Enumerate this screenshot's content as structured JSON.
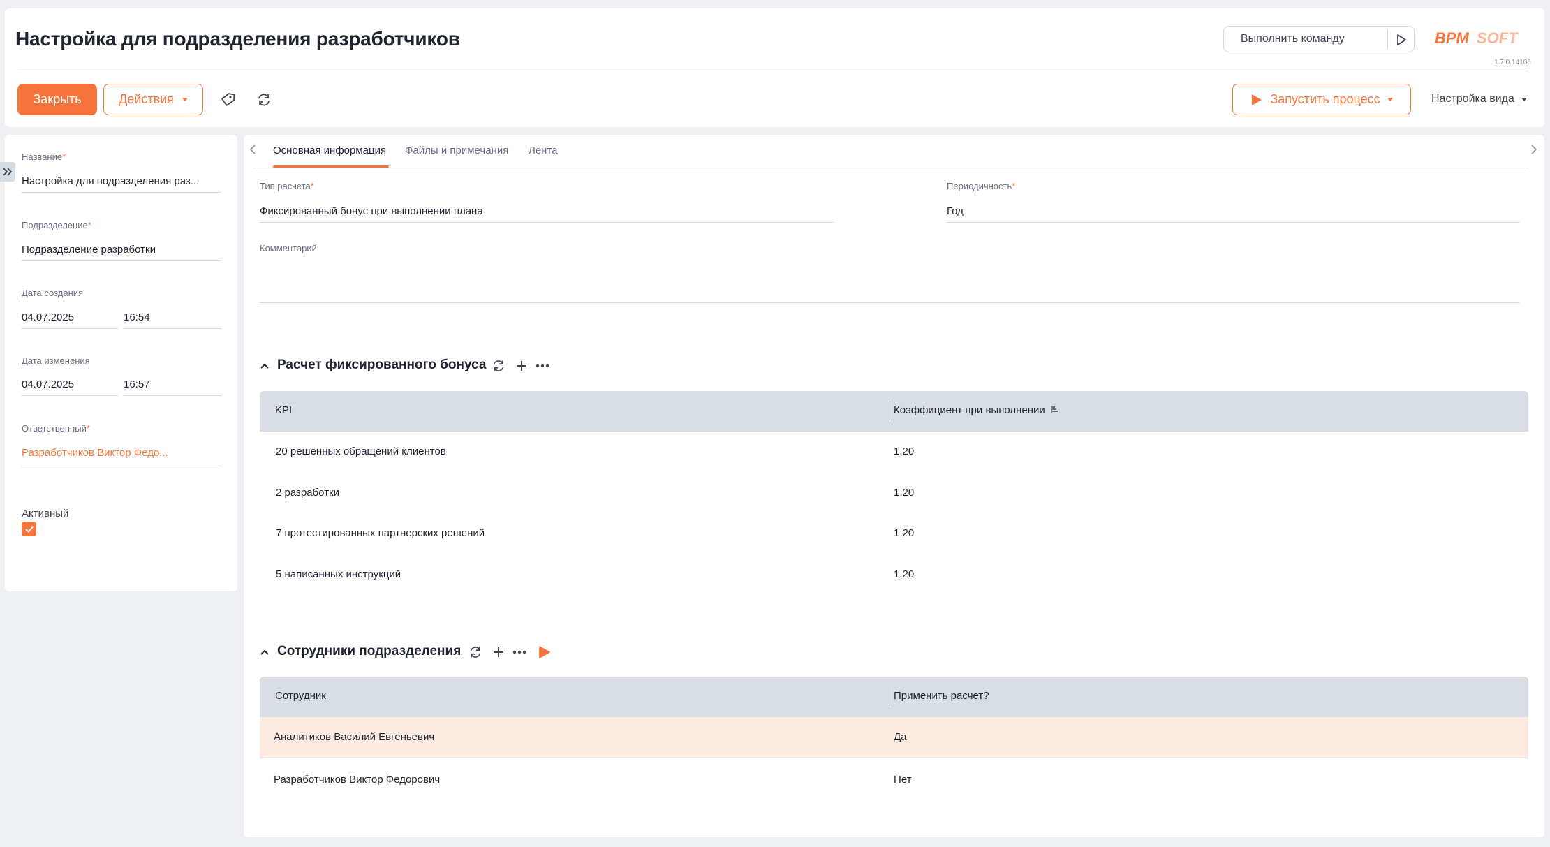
{
  "header": {
    "title": "Настройка для подразделения разработчиков",
    "command_placeholder": "Выполнить команду",
    "logo_text": "BPMSOFT",
    "version": "1.7.0.14106"
  },
  "toolbar": {
    "close_label": "Закрыть",
    "actions_label": "Действия",
    "tag_icon": "tag-icon",
    "refresh_icon": "refresh-icon",
    "run_process_label": "Запустить процесс",
    "view_settings_label": "Настройка вида"
  },
  "sidebar": {
    "name_label": "Название",
    "name_value": "Настройка для подразделения раз...",
    "department_label": "Подразделение",
    "department_value": "Подразделение разработки",
    "created_label": "Дата создания",
    "created_date": "04.07.2025",
    "created_time": "16:54",
    "modified_label": "Дата изменения",
    "modified_date": "04.07.2025",
    "modified_time": "16:57",
    "owner_label": "Ответственный",
    "owner_value": "Разработчиков Виктор Федо...",
    "active_label": "Активный",
    "active_checked": true
  },
  "tabs": [
    {
      "label": "Основная информация",
      "active": true
    },
    {
      "label": "Файлы и примечания",
      "active": false
    },
    {
      "label": "Лента",
      "active": false
    }
  ],
  "main": {
    "calc_type_label": "Тип расчета",
    "calc_type_value": "Фиксированный бонус при выполнении плана",
    "period_label": "Периодичность",
    "period_value": "Год",
    "comment_label": "Комментарий",
    "comment_value": ""
  },
  "bonus_section": {
    "title": "Расчет фиксированного бонуса",
    "columns": [
      "KPI",
      "Коэффициент при выполнении"
    ],
    "rows": [
      {
        "kpi": "20 решенных обращений клиентов",
        "coef": "1,20"
      },
      {
        "kpi": "2 разработки",
        "coef": "1,20"
      },
      {
        "kpi": "7 протестированных партнерских решений",
        "coef": "1,20"
      },
      {
        "kpi": "5 написанных инструкций",
        "coef": "1,20"
      }
    ]
  },
  "employees_section": {
    "title": "Сотрудники подразделения",
    "columns": [
      "Сотрудник",
      "Применить расчет?"
    ],
    "rows": [
      {
        "employee": "Аналитиков Василий Евгеньевич",
        "apply": "Да",
        "selected": true
      },
      {
        "employee": "Разработчиков Виктор Федорович",
        "apply": "Нет",
        "selected": false
      }
    ]
  },
  "colors": {
    "accent": "#f4743b",
    "grid_header": "#d9dde4",
    "selected_row": "#fdebe2"
  }
}
